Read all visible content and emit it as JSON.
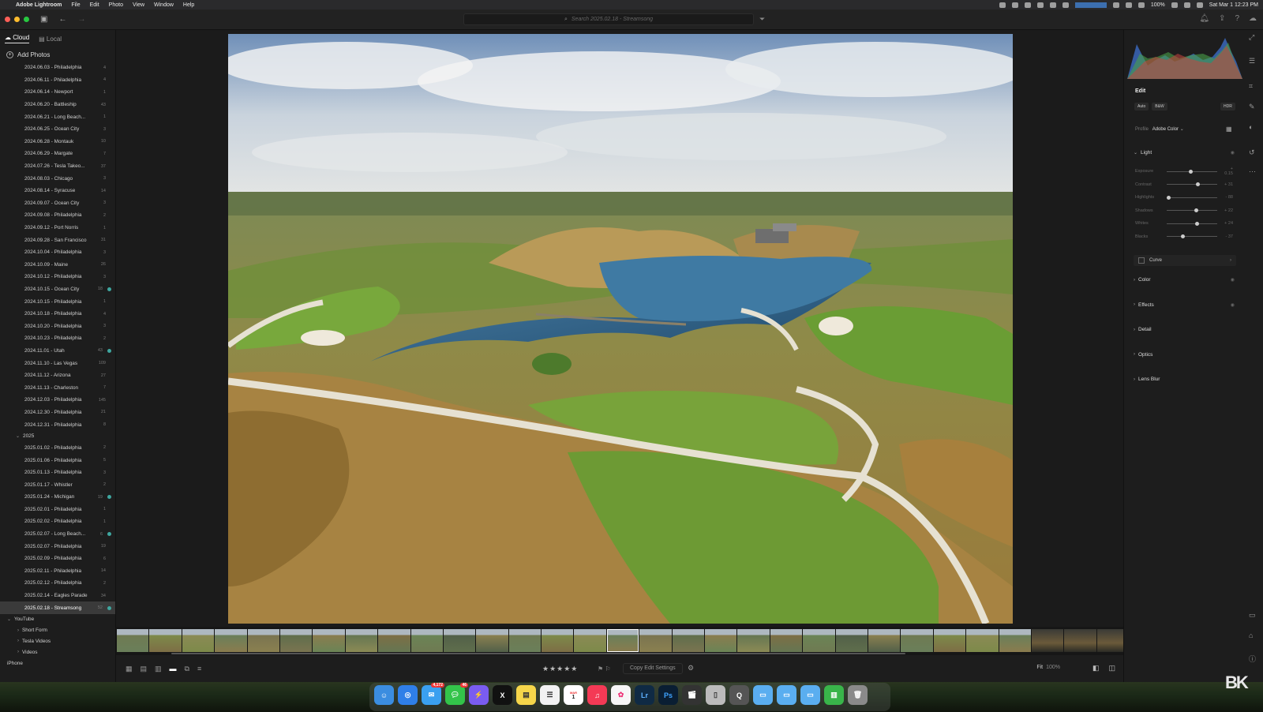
{
  "menubar": {
    "app": "Adobe Lightroom",
    "items": [
      "File",
      "Edit",
      "Photo",
      "View",
      "Window",
      "Help"
    ],
    "battery": "100%",
    "datetime": "Sat Mar 1  12:23 PM"
  },
  "titlebar": {
    "search_placeholder": "Search 2025.02.18 - Streamsong"
  },
  "sidebar": {
    "tabs": [
      {
        "label": "Cloud"
      },
      {
        "label": "Local"
      }
    ],
    "add_photos": "Add Photos",
    "albums_2024": [
      {
        "label": "2024.06.03 - Philadelphia",
        "count": "4"
      },
      {
        "label": "2024.06.11 - Philadelphia",
        "count": "4"
      },
      {
        "label": "2024.06.14 - Newport",
        "count": "1"
      },
      {
        "label": "2024.06.20 - Battleship",
        "count": "43"
      },
      {
        "label": "2024.06.21 - Long Beach...",
        "count": "1"
      },
      {
        "label": "2024.06.25 - Ocean City",
        "count": "3"
      },
      {
        "label": "2024.06.28 - Montauk",
        "count": "10"
      },
      {
        "label": "2024.06.29 - Margate",
        "count": "7"
      },
      {
        "label": "2024.07.26 - Tesla Takeo...",
        "count": "37"
      },
      {
        "label": "2024.08.03 - Chicago",
        "count": "3"
      },
      {
        "label": "2024.08.14 - Syracuse",
        "count": "14"
      },
      {
        "label": "2024.09.07 - Ocean City",
        "count": "3"
      },
      {
        "label": "2024.09.08 - Philadelphia",
        "count": "2"
      },
      {
        "label": "2024.09.12 - Port Norris",
        "count": "1"
      },
      {
        "label": "2024.09.28 - San Francisco",
        "count": "31"
      },
      {
        "label": "2024.10.04 - Philadelphia",
        "count": "3"
      },
      {
        "label": "2024.10.09 - Maine",
        "count": "26"
      },
      {
        "label": "2024.10.12 - Philadelphia",
        "count": "3"
      },
      {
        "label": "2024.10.15 - Ocean City",
        "count": "18",
        "sync": true
      },
      {
        "label": "2024.10.15 - Philadelphia",
        "count": "1"
      },
      {
        "label": "2024.10.18 - Philadelphia",
        "count": "4"
      },
      {
        "label": "2024.10.20 - Philadelphia",
        "count": "3"
      },
      {
        "label": "2024.10.23 - Philadelphia",
        "count": "2"
      },
      {
        "label": "2024.11.01 - Utah",
        "count": "43",
        "sync": true
      },
      {
        "label": "2024.11.10 - Las Vegas",
        "count": "109"
      },
      {
        "label": "2024.11.12 - Arizona",
        "count": "27"
      },
      {
        "label": "2024.11.13 - Charleston",
        "count": "7"
      },
      {
        "label": "2024.12.03 - Philadelphia",
        "count": "145"
      },
      {
        "label": "2024.12.30 - Philadelphia",
        "count": "21"
      },
      {
        "label": "2024.12.31 - Philadelphia",
        "count": "8"
      }
    ],
    "folder_2025": "2025",
    "albums_2025": [
      {
        "label": "2025.01.02 - Philadelphia",
        "count": "2"
      },
      {
        "label": "2025.01.06 - Philadelphia",
        "count": "5"
      },
      {
        "label": "2025.01.13 - Philadelphia",
        "count": "3"
      },
      {
        "label": "2025.01.17 - Whistler",
        "count": "2"
      },
      {
        "label": "2025.01.24 - Michigan",
        "count": "19",
        "sync": true
      },
      {
        "label": "2025.02.01 - Philadelphia",
        "count": "1"
      },
      {
        "label": "2025.02.02 - Philadelphia",
        "count": "1"
      },
      {
        "label": "2025.02.07 - Long Beach...",
        "count": "6",
        "sync": true
      },
      {
        "label": "2025.02.07 - Philadelphia",
        "count": "19"
      },
      {
        "label": "2025.02.09 - Philadelphia",
        "count": "6"
      },
      {
        "label": "2025.02.11 - Philadelphia",
        "count": "14"
      },
      {
        "label": "2025.02.12 - Philadelphia",
        "count": "2"
      },
      {
        "label": "2025.02.14 - Eagles Parade",
        "count": "34"
      },
      {
        "label": "2025.02.18 - Streamsong",
        "count": "52",
        "sync": true,
        "selected": true
      }
    ],
    "folder_youtube": "YouTube",
    "youtube_children": [
      "Short Form",
      "Tesla Videos",
      "Videos"
    ],
    "iphone": "iPhone"
  },
  "bottombar": {
    "stars": "★★★★★",
    "copy_edit": "Copy Edit Settings",
    "fit": "Fit",
    "zoom": "100%"
  },
  "edit_panel": {
    "title": "Edit",
    "tabs": [
      "Auto",
      "B&W"
    ],
    "hdr": "HDR",
    "profile_label": "Profile",
    "profile_value": "Adobe Color",
    "light": "Light",
    "sliders": [
      {
        "label": "Exposure",
        "value": "+ 0.15",
        "pos": 0.48
      },
      {
        "label": "Contrast",
        "value": "+ 31",
        "pos": 0.62
      },
      {
        "label": "Highlights",
        "value": "- 88",
        "pos": 0.04
      },
      {
        "label": "Shadows",
        "value": "+ 22",
        "pos": 0.58
      },
      {
        "label": "Whites",
        "value": "+ 24",
        "pos": 0.6
      },
      {
        "label": "Blacks",
        "value": "- 37",
        "pos": 0.32
      }
    ],
    "curve": "Curve",
    "sections": [
      "Color",
      "Effects",
      "Detail",
      "Optics",
      "Lens Blur"
    ]
  },
  "dock": {
    "mail_badge": "4,172",
    "messages_badge": "46",
    "calendar_day": "1",
    "calendar_month": "MAR"
  },
  "watermark": "BK",
  "colors": {
    "accent_sync": "#3fa7a0",
    "selected_row": "#3a3a3a"
  }
}
